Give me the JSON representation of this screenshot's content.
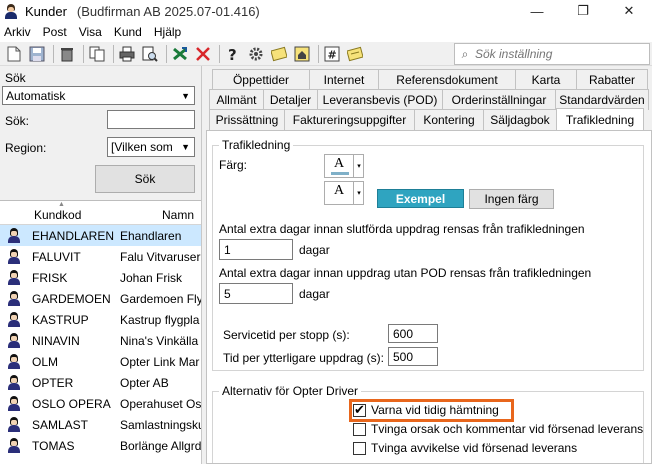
{
  "window": {
    "title": "Kunder",
    "subtitle": "(Budfirman AB 2025.07-01.416)",
    "controls": [
      "—",
      "❐",
      "✕"
    ]
  },
  "menu": [
    "Arkiv",
    "Post",
    "Visa",
    "Kund",
    "Hjälp"
  ],
  "toolbar": {
    "search_placeholder": "Sök inställning"
  },
  "left": {
    "search_label": "Sök",
    "search_mode": "Automatisk",
    "sok_label": "Sök:",
    "region_label": "Region:",
    "region_value": "[Vilken som",
    "search_button": "Sök",
    "columns": [
      "Kundkod",
      "Namn"
    ],
    "rows": [
      {
        "code": "EHANDLAREN",
        "name": "Ehandlaren"
      },
      {
        "code": "FALUVIT",
        "name": "Falu Vitvaruser"
      },
      {
        "code": "FRISK",
        "name": "Johan Frisk"
      },
      {
        "code": "GARDEMOEN",
        "name": "Gardemoen Fly"
      },
      {
        "code": "KASTRUP",
        "name": "Kastrup flygpla"
      },
      {
        "code": "NINAVIN",
        "name": "Nina's Vinkälla"
      },
      {
        "code": "OLM",
        "name": "Opter Link Mar"
      },
      {
        "code": "OPTER",
        "name": "Opter AB"
      },
      {
        "code": "OSLO OPERA",
        "name": "Operahuset Os"
      },
      {
        "code": "SAMLAST",
        "name": "Samlastningsku"
      },
      {
        "code": "TOMAS",
        "name": "Borlänge Allgrd"
      }
    ]
  },
  "tabs": {
    "row1": [
      "Öppettider",
      "Internet",
      "Referensdokument",
      "Karta",
      "Rabatter"
    ],
    "row2": [
      "Allmänt",
      "Detaljer",
      "Leveransbevis (POD)",
      "Orderinställningar",
      "Standardvärden"
    ],
    "row3": [
      "Prissättning",
      "Faktureringsuppgifter",
      "Kontering",
      "Säljdagbok",
      "Trafikledning"
    ]
  },
  "trafik": {
    "group_title": "Trafikledning",
    "color_label": "Färg:",
    "color_glyph": "A",
    "dropdown_glyph": "▾",
    "example_label": "Exempel",
    "no_color_label": "Ingen färg",
    "extra_days_done_label": "Antal extra dagar innan slutförda uppdrag rensas från trafikledningen",
    "extra_days_done_value": "1",
    "days_unit": "dagar",
    "extra_days_pod_label": "Antal extra dagar innan uppdrag utan POD rensas från trafikledningen",
    "extra_days_pod_value": "5",
    "service_time_label": "Servicetid per stopp (s):",
    "service_time_value": "600",
    "extra_time_label": "Tid per ytterligare uppdrag (s):",
    "extra_time_value": "500"
  },
  "driver": {
    "group_title": "Alternativ för Opter Driver",
    "options": [
      {
        "label": "Varna vid tidig hämtning",
        "checked": true
      },
      {
        "label": "Tvinga orsak och kommentar vid försenad leverans",
        "checked": false
      },
      {
        "label": "Tvinga avvikelse vid försenad leverans",
        "checked": false
      }
    ]
  },
  "colors": {
    "highlight": "#e8661c",
    "example_bg": "#2fa4c0",
    "selected_row": "#cce8ff"
  }
}
